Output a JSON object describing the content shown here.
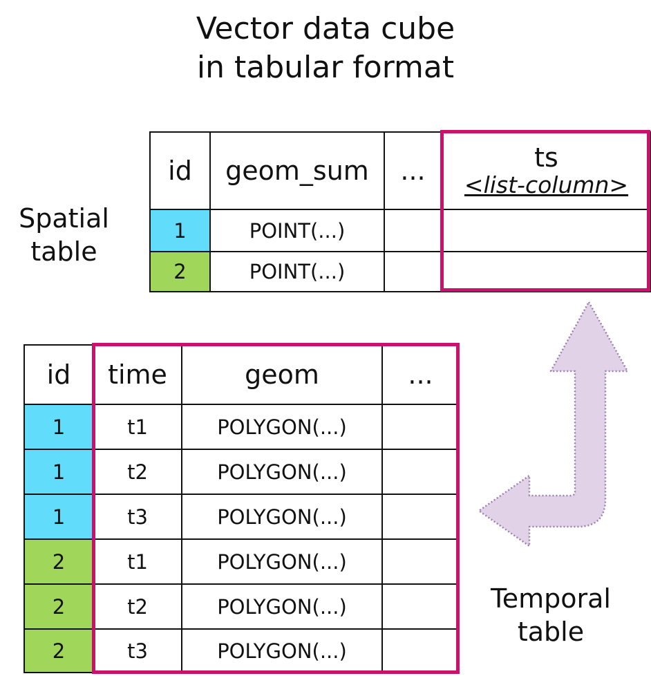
{
  "title": {
    "line1": "Vector data cube",
    "line2": "in tabular format"
  },
  "spatial": {
    "label_line1": "Spatial",
    "label_line2": "table",
    "headers": {
      "id": "id",
      "geom": "geom_sum",
      "more": "...",
      "ts": "ts",
      "ts_sub": "<list-column>"
    },
    "rows": [
      {
        "id": "1",
        "geom": "POINT(...)"
      },
      {
        "id": "2",
        "geom": "POINT(...)"
      }
    ]
  },
  "temporal": {
    "label_line1": "Temporal",
    "label_line2": "table",
    "headers": {
      "id": "id",
      "time": "time",
      "geom": "geom",
      "more": "..."
    },
    "rows": [
      {
        "id": "1",
        "time": "t1",
        "geom": "POLYGON(...)"
      },
      {
        "id": "1",
        "time": "t2",
        "geom": "POLYGON(...)"
      },
      {
        "id": "1",
        "time": "t3",
        "geom": "POLYGON(...)"
      },
      {
        "id": "2",
        "time": "t1",
        "geom": "POLYGON(...)"
      },
      {
        "id": "2",
        "time": "t2",
        "geom": "POLYGON(...)"
      },
      {
        "id": "2",
        "time": "t3",
        "geom": "POLYGON(...)"
      }
    ]
  },
  "colors": {
    "id_1": "#61dcfb",
    "id_2": "#a0d65a",
    "highlight": "#c8126b",
    "arrow_fill": "#e1d2e8",
    "arrow_stroke": "#9c7fb0"
  },
  "icons": {
    "connector": "bent-double-arrow-icon"
  }
}
